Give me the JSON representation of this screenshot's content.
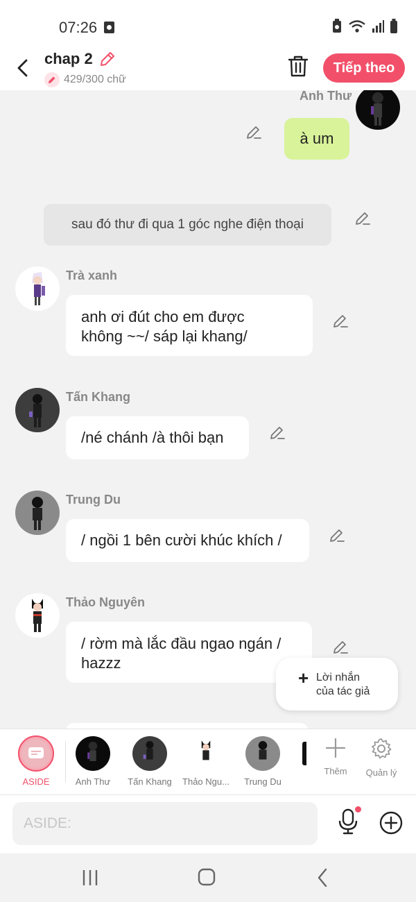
{
  "status": {
    "time": "07:26"
  },
  "header": {
    "title": "chap 2",
    "word_count": "429/300 chữ",
    "next_label": "Tiếp theo"
  },
  "messages": [
    {
      "type": "right",
      "name": "Anh Thư",
      "text": "à um"
    },
    {
      "type": "narration",
      "text": "sau đó thư đi qua 1 góc nghe điện thoại"
    },
    {
      "type": "left",
      "name": "Trà xanh",
      "lines": [
        "anh ơi đút cho em được",
        "không ~~/ sáp lại khang/"
      ]
    },
    {
      "type": "left",
      "name": "Tấn Khang",
      "text": "/né chánh /à thôi bạn"
    },
    {
      "type": "left",
      "name": "Trung Du",
      "text": "/ ngồi 1 bên cười khúc khích /"
    },
    {
      "type": "left",
      "name": "Thảo Nguyên",
      "lines": [
        "/ rờm mà lắc đầu ngao ngán /",
        "hazzz"
      ]
    }
  ],
  "author_note": {
    "line1": "Lời nhắn",
    "line2": "của tác giả"
  },
  "characters": {
    "aside_label": "ASIDE",
    "items": [
      "Anh Thư",
      "Tấn Khang",
      "Thảo Ngu...",
      "Trung Du"
    ],
    "add_label": "Thêm",
    "manage_label": "Quản lý"
  },
  "input": {
    "placeholder": "ASIDE:"
  },
  "colors": {
    "accent": "#f2506a",
    "my_bubble": "#d9f39a",
    "background": "#f2f2f2"
  }
}
